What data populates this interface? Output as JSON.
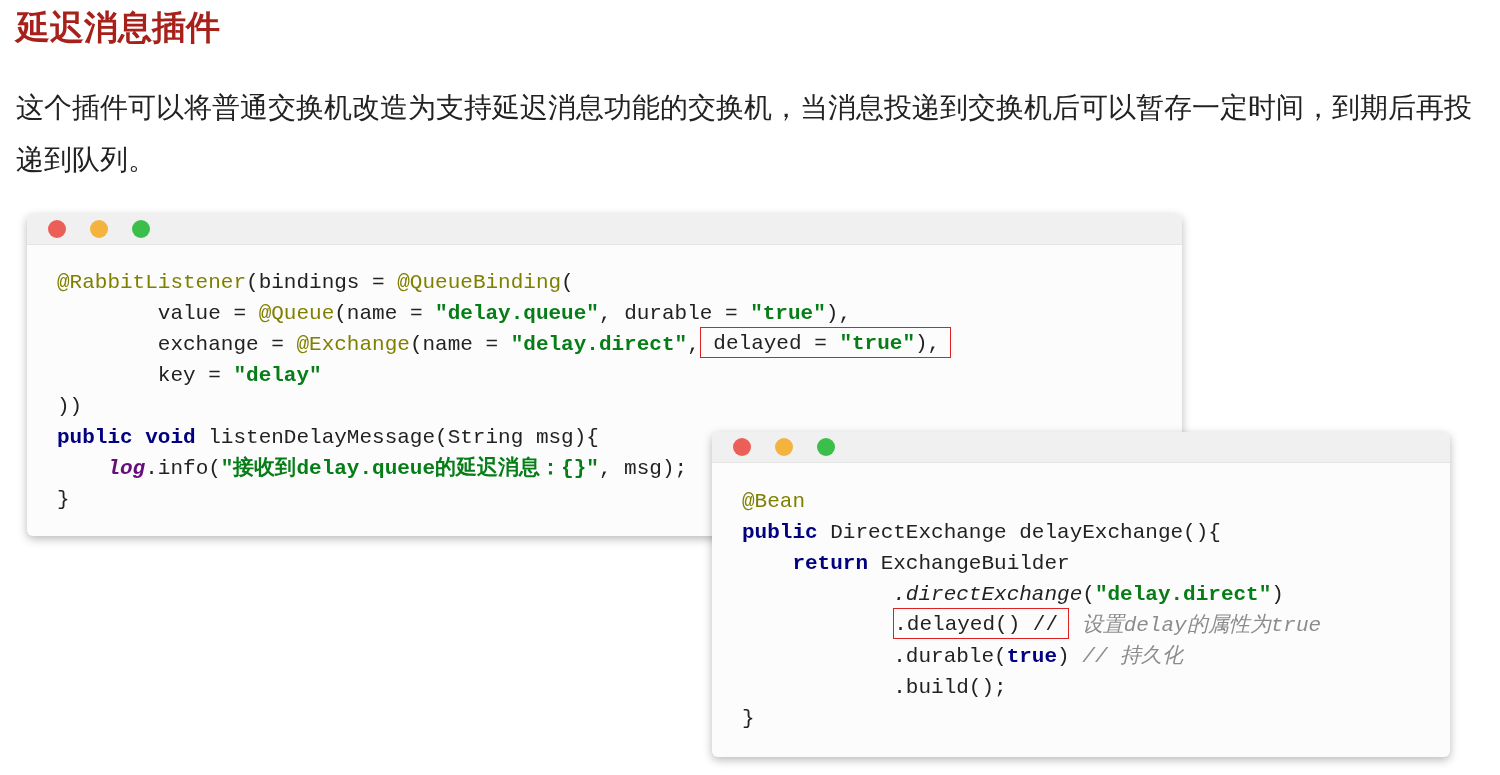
{
  "heading": "延迟消息插件",
  "paragraph": "这个插件可以将普通交换机改造为支持延迟消息功能的交换机，当消息投递到交换机后可以暂存一定时间，到期后再投递到队列。",
  "windows": [
    {
      "lines": [
        [
          {
            "kind": "annotation",
            "text": "@RabbitListener"
          },
          {
            "kind": "plain",
            "text": "(bindings = "
          },
          {
            "kind": "annotation",
            "text": "@QueueBinding"
          },
          {
            "kind": "plain",
            "text": "("
          }
        ],
        [
          {
            "kind": "plain",
            "text": "        value = "
          },
          {
            "kind": "annotation",
            "text": "@Queue"
          },
          {
            "kind": "plain",
            "text": "(name = "
          },
          {
            "kind": "string",
            "text": "\"delay.queue\""
          },
          {
            "kind": "plain",
            "text": ", durable = "
          },
          {
            "kind": "string",
            "text": "\"true\""
          },
          {
            "kind": "plain",
            "text": "),"
          }
        ],
        [
          {
            "kind": "plain",
            "text": "        exchange = "
          },
          {
            "kind": "annotation",
            "text": "@Exchange"
          },
          {
            "kind": "plain",
            "text": "(name = "
          },
          {
            "kind": "string",
            "text": "\"delay.direct\""
          },
          {
            "kind": "plain",
            "text": ","
          },
          {
            "kind": "box",
            "tokens": [
              {
                "kind": "plain",
                "text": " delayed = "
              },
              {
                "kind": "string",
                "text": "\"true\""
              },
              {
                "kind": "plain",
                "text": "),"
              }
            ]
          }
        ],
        [
          {
            "kind": "plain",
            "text": "        key = "
          },
          {
            "kind": "string",
            "text": "\"delay\""
          }
        ],
        [
          {
            "kind": "plain",
            "text": "))"
          }
        ],
        [
          {
            "kind": "keyword",
            "text": "public void"
          },
          {
            "kind": "plain",
            "text": " listenDelayMessage(String msg){"
          }
        ],
        [
          {
            "kind": "field",
            "text": "    log"
          },
          {
            "kind": "plain",
            "text": ".info("
          },
          {
            "kind": "string",
            "text": "\"接收到delay.queue的延迟消息：{}\""
          },
          {
            "kind": "plain",
            "text": ", msg);"
          }
        ],
        [
          {
            "kind": "plain",
            "text": "}"
          }
        ]
      ]
    },
    {
      "lines": [
        [
          {
            "kind": "annotation",
            "text": "@Bean"
          }
        ],
        [
          {
            "kind": "keyword",
            "text": "public"
          },
          {
            "kind": "plain",
            "text": " DirectExchange delayExchange(){"
          }
        ],
        [
          {
            "kind": "keyword",
            "text": "    return"
          },
          {
            "kind": "plain",
            "text": " ExchangeBuilder"
          }
        ],
        [
          {
            "kind": "italic",
            "text": "            .directExchange"
          },
          {
            "kind": "plain",
            "text": "("
          },
          {
            "kind": "string",
            "text": "\"delay.direct\""
          },
          {
            "kind": "plain",
            "text": ")"
          }
        ],
        [
          {
            "kind": "box",
            "tokens": [
              {
                "kind": "plain",
                "text": "            .delayed() //"
              }
            ]
          },
          {
            "kind": "comment",
            "text": " 设置delay的属性为true"
          }
        ],
        [
          {
            "kind": "plain",
            "text": "            .durable("
          },
          {
            "kind": "keyword",
            "text": "true"
          },
          {
            "kind": "plain",
            "text": ") "
          },
          {
            "kind": "comment",
            "text": "// 持久化"
          }
        ],
        [
          {
            "kind": "plain",
            "text": "            .build();"
          }
        ],
        [
          {
            "kind": "plain",
            "text": "}"
          }
        ]
      ]
    }
  ]
}
